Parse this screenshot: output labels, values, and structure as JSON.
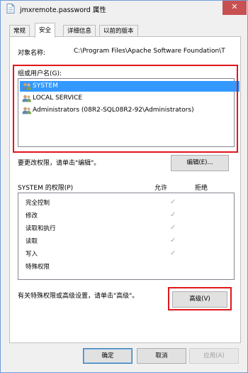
{
  "window": {
    "title": "jmxremote.password 属性",
    "close_glyph": "✕"
  },
  "tabs": [
    "常规",
    "安全",
    "详细信息",
    "以前的版本"
  ],
  "active_tab": "安全",
  "object": {
    "label": "对象名称:",
    "path": "C:\\Program Files\\Apache Software Foundation\\T"
  },
  "groups": {
    "label": "组或用户名(G):",
    "items": [
      "SYSTEM",
      "LOCAL SERVICE",
      "Administrators (08R2-SQL08R2-92\\Administrators)"
    ],
    "selected_index": 0
  },
  "edit": {
    "hint": "要更改权限，请单击\"编辑\"。",
    "button": "编辑(E)..."
  },
  "permissions": {
    "header": "SYSTEM 的权限(P)",
    "allow_header": "允许",
    "deny_header": "拒绝",
    "rows": [
      {
        "name": "完全控制",
        "allow": true,
        "deny": false
      },
      {
        "name": "修改",
        "allow": true,
        "deny": false
      },
      {
        "name": "读取和执行",
        "allow": true,
        "deny": false
      },
      {
        "name": "读取",
        "allow": true,
        "deny": false
      },
      {
        "name": "写入",
        "allow": true,
        "deny": false
      },
      {
        "name": "特殊权限",
        "allow": false,
        "deny": false
      }
    ],
    "check_glyph": "✓"
  },
  "advanced": {
    "hint": "有关特殊权限或高级设置，请单击\"高级\"。",
    "button": "高级(V)"
  },
  "footer": {
    "ok": "确定",
    "cancel": "取消",
    "apply": "应用(A)"
  },
  "colors": {
    "selection": "#3399ff",
    "highlight_box": "#e0171d",
    "close_button": "#c75050"
  }
}
